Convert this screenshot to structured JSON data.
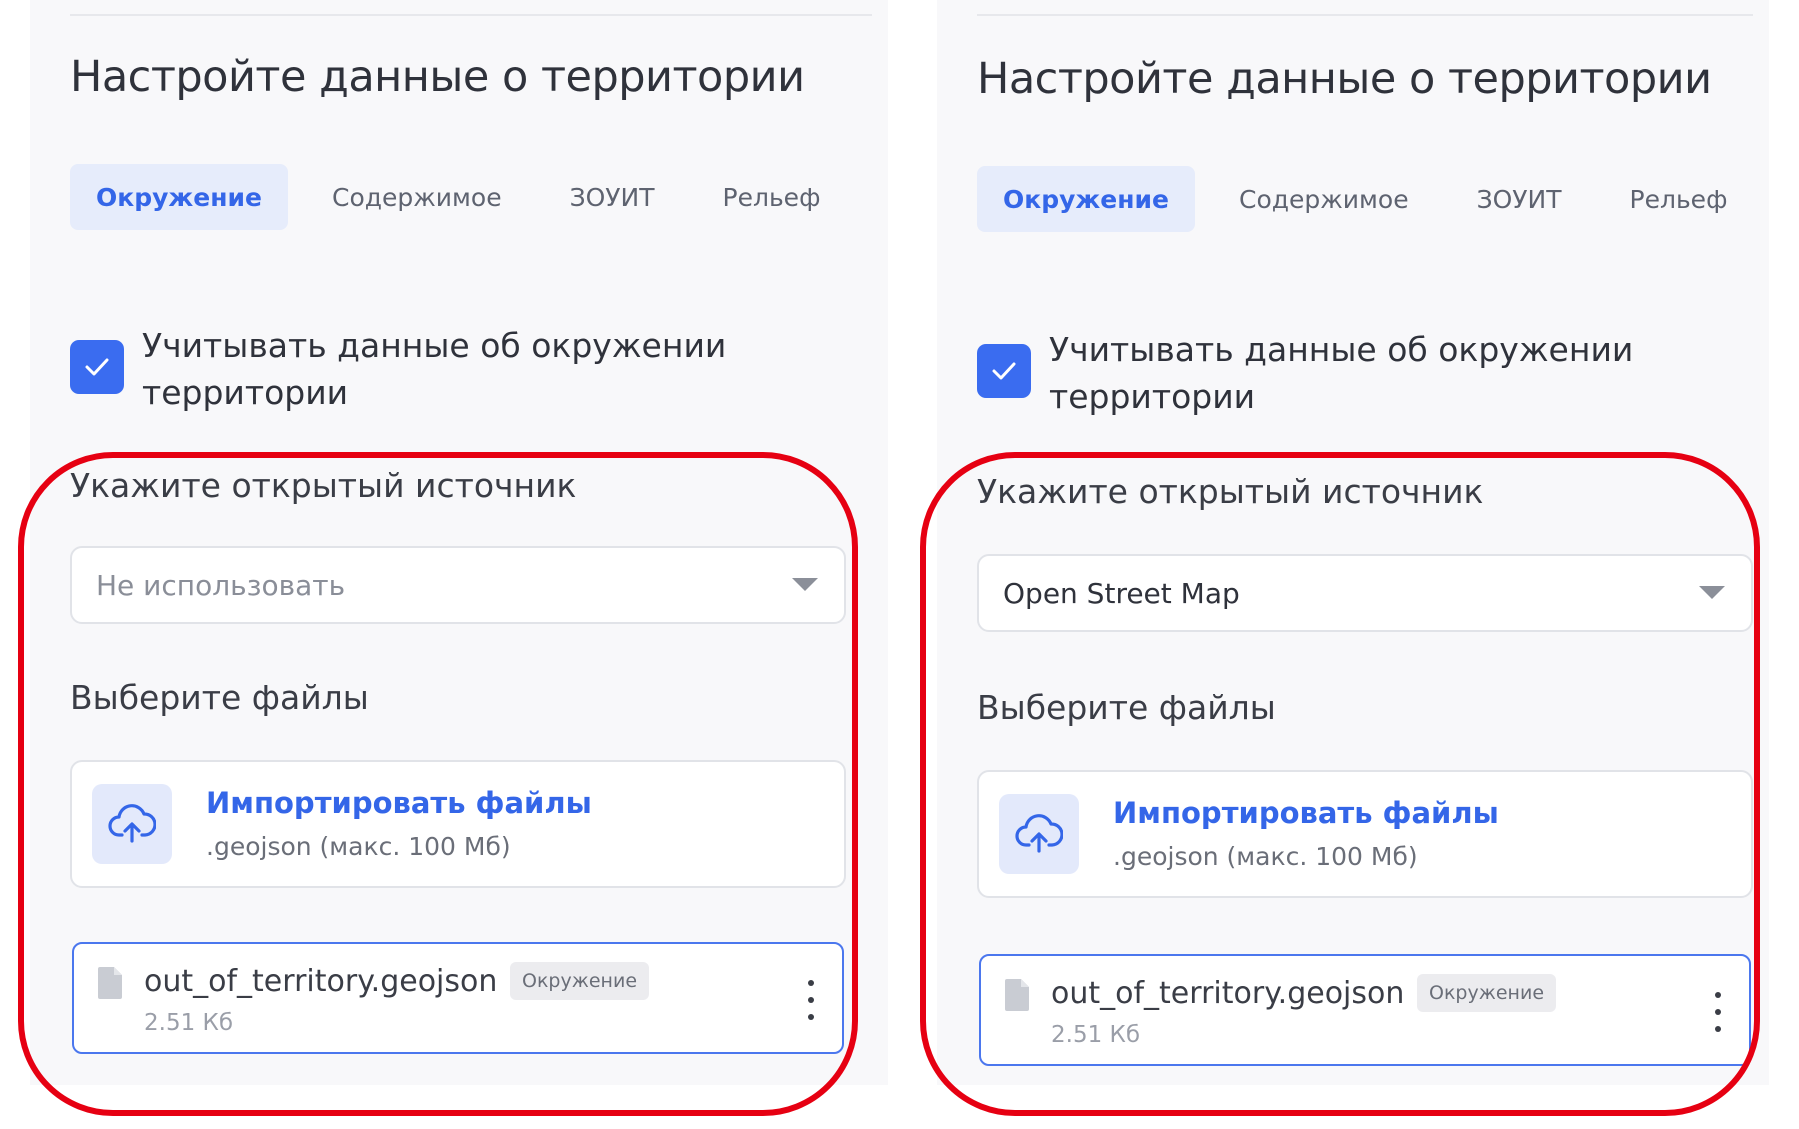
{
  "panels": [
    {
      "title": "Настройте данные о территории",
      "tabs": [
        {
          "label": "Окружение"
        },
        {
          "label": "Содержимое"
        },
        {
          "label": "ЗОУИТ"
        },
        {
          "label": "Рельеф"
        }
      ],
      "checkbox": {
        "checked": true,
        "label": "Учитывать данные об окружении территории"
      },
      "source": {
        "label": "Укажите открытый источник",
        "value": "Не использовать",
        "is_placeholder": true
      },
      "files": {
        "label": "Выберите файлы"
      },
      "upload": {
        "title": "Импортировать файлы",
        "subtitle": ".geojson (макс. 100 Мб)"
      },
      "file_item": {
        "name": "out_of_territory.geojson",
        "badge": "Окружение",
        "size": "2.51 Кб"
      }
    },
    {
      "title": "Настройте данные о территории",
      "tabs": [
        {
          "label": "Окружение"
        },
        {
          "label": "Содержимое"
        },
        {
          "label": "ЗОУИТ"
        },
        {
          "label": "Рельеф"
        }
      ],
      "checkbox": {
        "checked": true,
        "label": "Учитывать данные об окружении территории"
      },
      "source": {
        "label": "Укажите открытый источник",
        "value": "Open Street Map",
        "is_placeholder": false
      },
      "files": {
        "label": "Выберите файлы"
      },
      "upload": {
        "title": "Импортировать файлы",
        "subtitle": ".geojson (макс. 100 Мб)"
      },
      "file_item": {
        "name": "out_of_territory.geojson",
        "badge": "Окружение",
        "size": "2.51 Кб"
      }
    }
  ],
  "colors": {
    "accent": "#3466e8",
    "highlight": "#e60012",
    "panel_bg": "#f8f8fa"
  },
  "icons": {
    "checkbox": "check-icon",
    "upload": "cloud-upload-icon",
    "file": "file-icon",
    "menu": "more-vertical-icon",
    "select": "caret-down-icon"
  }
}
